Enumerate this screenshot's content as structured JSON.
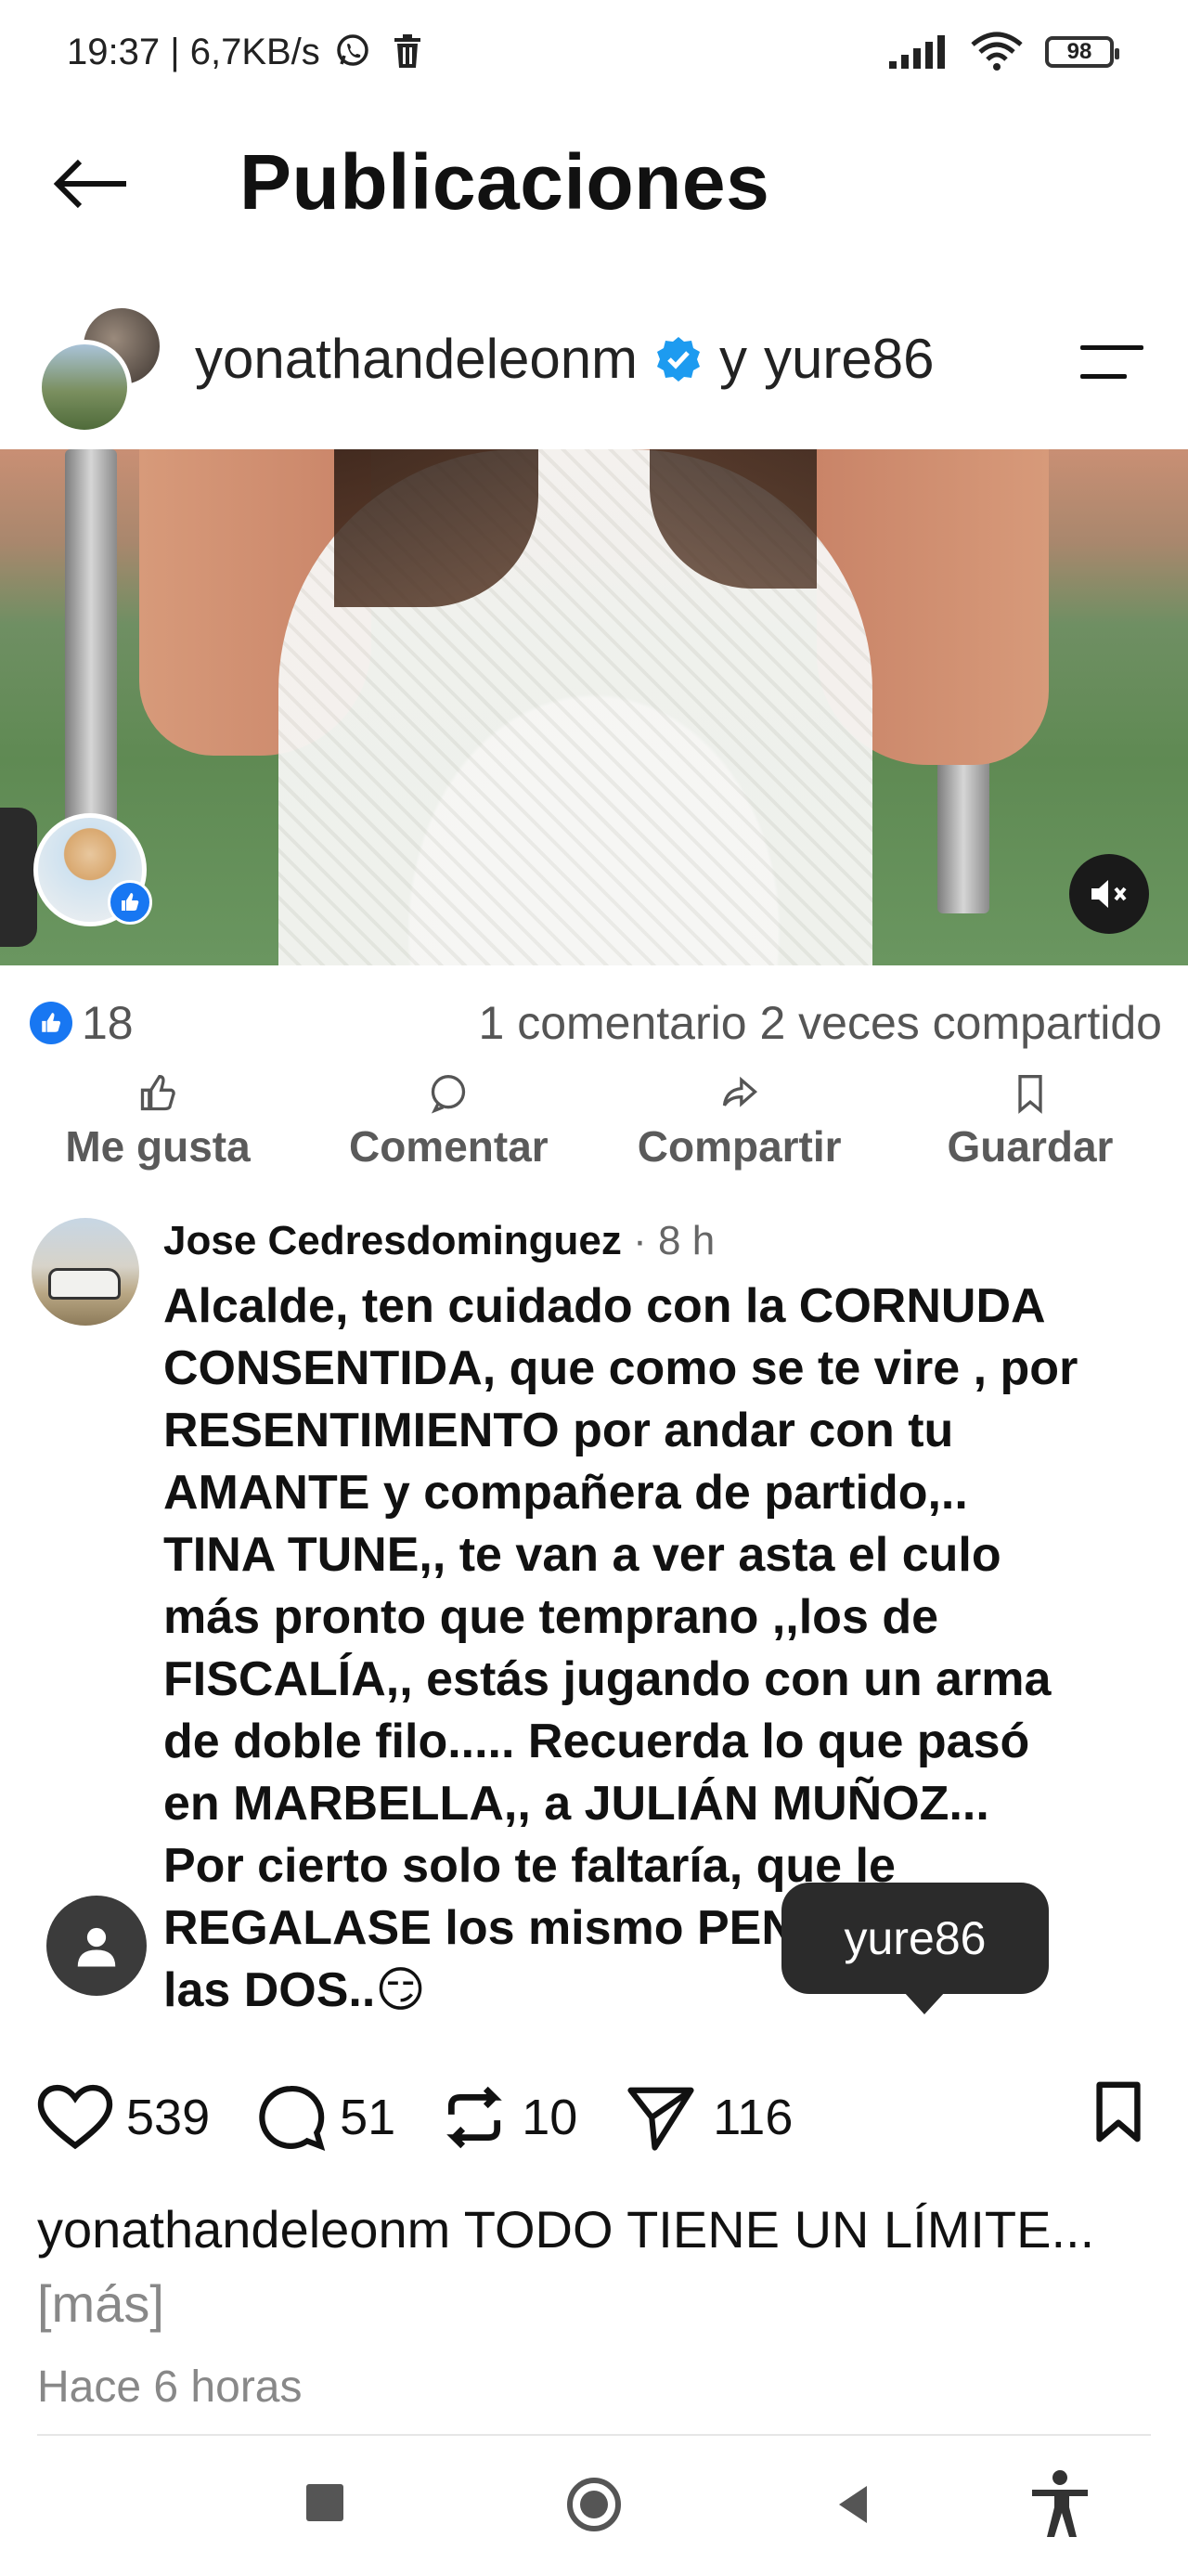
{
  "status_bar": {
    "time": "19:37 | 6,7KB/s",
    "battery": "98",
    "icons": [
      "whatsapp-icon",
      "trash-icon",
      "signal-icon",
      "wifi-icon",
      "battery-icon"
    ]
  },
  "header": {
    "title": "Publicaciones",
    "back_icon": "arrow-left-icon"
  },
  "post": {
    "author": "yonathandeleonm",
    "connector": "y",
    "coauthor": "yure86",
    "verified": true,
    "menu_icon": "menu-icon"
  },
  "media": {
    "mute_icon": "speaker-mute-icon"
  },
  "fb_reactions": {
    "likes": "18",
    "stats": "1 comentario  2 veces compartido"
  },
  "fb_actions": [
    {
      "label": "Me gusta",
      "icon": "thumbs-up-icon"
    },
    {
      "label": "Comentar",
      "icon": "comment-icon"
    },
    {
      "label": "Compartir",
      "icon": "share-icon"
    },
    {
      "label": "Guardar",
      "icon": "bookmark-icon"
    }
  ],
  "comment": {
    "name": "Jose Cedresdominguez",
    "time": " · 8 h",
    "text": "Alcalde, ten cuidado con la CORNUDA\nCONSENTIDA, que como se te vire , por\nRESENTIMIENTO por andar con tu\nAMANTE y compañera de  partido,..\nTINA TUNE,, te van a ver asta el culo\nmás pronto que temprano ,,los de\nFISCALÍA,, estás jugando con un arma\nde doble filo..... Recuerda lo que pasó\nen MARBELLA,, a JULIÁN MUÑOZ...\nPor cierto solo te faltaría, que le\nREGALASE los mismo PENDIENTES a\nlas DOS..😏"
  },
  "tooltip": {
    "label": "yure86"
  },
  "threads_actions": {
    "likes": "539",
    "comments": "51",
    "reposts": "10",
    "shares": "116"
  },
  "caption": {
    "user": "yonathandeleonm",
    "text": " TODO TIENE UN LÍMITE... ",
    "more": "[más]"
  },
  "timestamp": "Hace 6 horas",
  "nav": [
    "recents-button",
    "home-button",
    "back-button",
    "accessibility-button"
  ]
}
